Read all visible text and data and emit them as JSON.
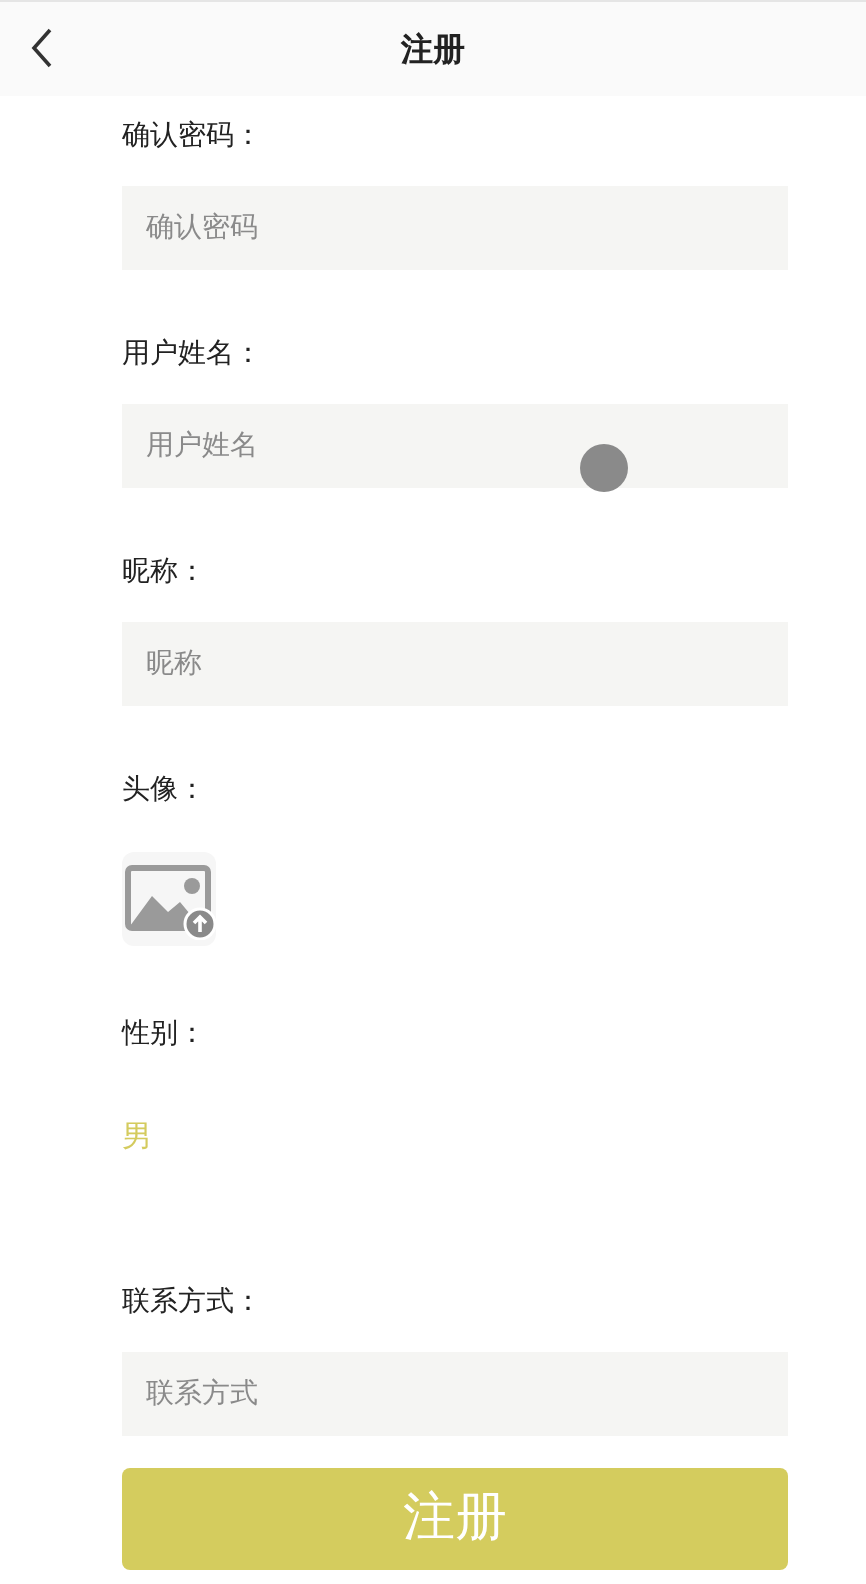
{
  "header": {
    "title": "注册"
  },
  "fields": [
    {
      "kind": "text",
      "label": "确认密码：",
      "placeholder": "确认密码"
    },
    {
      "kind": "text",
      "label": "用户姓名：",
      "placeholder": "用户姓名"
    },
    {
      "kind": "text",
      "label": "昵称：",
      "placeholder": "昵称"
    },
    {
      "kind": "avatar",
      "label": "头像："
    },
    {
      "kind": "gender",
      "label": "性别：",
      "options": [
        {
          "label": "男",
          "selected": true
        }
      ]
    },
    {
      "kind": "text",
      "label": "联系方式：",
      "placeholder": "联系方式"
    }
  ],
  "submit": {
    "label": "注册"
  }
}
